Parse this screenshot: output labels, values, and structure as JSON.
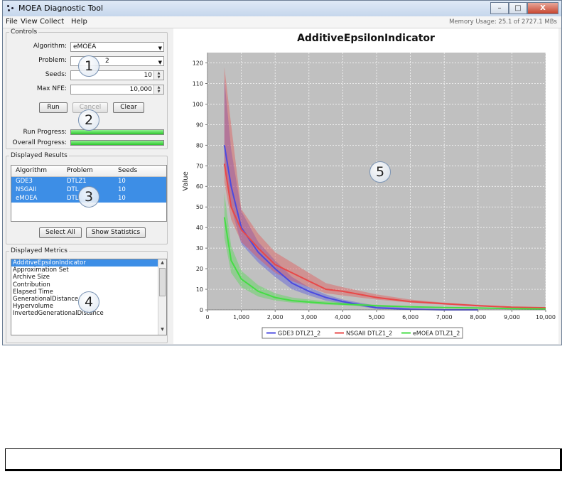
{
  "window": {
    "title": "MOEA Diagnostic Tool",
    "buttons": [
      "–",
      "□",
      "X"
    ]
  },
  "menu": {
    "items": [
      "File",
      "View",
      "Collect",
      "Help"
    ],
    "memory": "Memory Usage: 25.1 of 2727.1 MBs"
  },
  "controls": {
    "legend": "Controls",
    "algorithm_label": "Algorithm:",
    "algorithm_value": "eMOEA",
    "problem_label": "Problem:",
    "problem_value": "2",
    "seeds_label": "Seeds:",
    "seeds_value": "10",
    "maxnfe_label": "Max NFE:",
    "maxnfe_value": "10,000",
    "run_label": "Run",
    "cancel_label": "Cancel",
    "clear_label": "Clear",
    "run_progress_label": "Run Progress:",
    "overall_progress_label": "Overall Progress:",
    "run_progress": 1.0,
    "overall_progress": 1.0
  },
  "results": {
    "legend": "Displayed Results",
    "columns": [
      "Algorithm",
      "Problem",
      "Seeds"
    ],
    "rows": [
      {
        "algorithm": "GDE3",
        "problem": "DTLZ1",
        "seeds": "10"
      },
      {
        "algorithm": "NSGAII",
        "problem": "DTL",
        "seeds": "10"
      },
      {
        "algorithm": "eMOEA",
        "problem": "DTL",
        "seeds": "10"
      }
    ],
    "select_all_label": "Select All",
    "show_stats_label": "Show Statistics"
  },
  "metrics": {
    "legend": "Displayed Metrics",
    "items": [
      "AdditiveEpsilonIndicator",
      "Approximation Set",
      "Archive Size",
      "Contribution",
      "Elapsed Time",
      "GenerationalDistance",
      "Hypervolume",
      "InvertedGenerationalDistance"
    ]
  },
  "callouts": [
    "1",
    "2",
    "3",
    "4",
    "5"
  ],
  "colors": {
    "gde3": "#4a4ae0",
    "nsga": "#e84848",
    "emoea": "#44dd44",
    "plot_bg": "#c0c0c0",
    "selection": "#3d8ee6"
  },
  "chart_data": {
    "type": "line",
    "title": "AdditiveEpsilonIndicator",
    "xlabel": "",
    "ylabel": "Value",
    "xlim": [
      0,
      10000
    ],
    "ylim": [
      0,
      125
    ],
    "x_ticks": [
      0,
      1000,
      2000,
      3000,
      4000,
      5000,
      6000,
      7000,
      8000,
      9000,
      10000
    ],
    "x_tick_labels": [
      "0",
      "1,000",
      "2,000",
      "3,000",
      "4,000",
      "5,000",
      "6,000",
      "7,000",
      "8,000",
      "9,000",
      "10,000"
    ],
    "y_ticks": [
      0,
      10,
      20,
      30,
      40,
      50,
      60,
      70,
      80,
      90,
      100,
      110,
      120
    ],
    "grid": true,
    "legend_position": "bottom",
    "series": [
      {
        "name": "GDE3 DTLZ1_2",
        "color": "#4a4ae0",
        "x": [
          500,
          700,
          1000,
          1500,
          2000,
          2500,
          3000,
          3500,
          4000,
          5000,
          6000,
          7000,
          8000
        ],
        "y": [
          80,
          60,
          40,
          28,
          20,
          13,
          9,
          6,
          4,
          1,
          0.3,
          0,
          0
        ],
        "lower": [
          72,
          50,
          32,
          23,
          16,
          10,
          7,
          4.5,
          3,
          0.5,
          0,
          0,
          0
        ],
        "upper": [
          112,
          78,
          48,
          33,
          24,
          16,
          11,
          7.5,
          5,
          2,
          0.8,
          0.2,
          0
        ]
      },
      {
        "name": "NSGAII DTLZ1_2",
        "color": "#e84848",
        "x": [
          500,
          700,
          1000,
          1500,
          2000,
          2500,
          3000,
          3500,
          4000,
          5000,
          6000,
          7000,
          8000,
          9000,
          10000
        ],
        "y": [
          71,
          50,
          39,
          30,
          22,
          18,
          14,
          10,
          9,
          6,
          4,
          3,
          2,
          1.3,
          1
        ],
        "lower": [
          62,
          44,
          33,
          25,
          18,
          14,
          11,
          8,
          7,
          5,
          3.5,
          2.5,
          1.7,
          1.1,
          0.8
        ],
        "upper": [
          118,
          90,
          49,
          37,
          28,
          23,
          18,
          13,
          11,
          7.5,
          5,
          3.5,
          2.5,
          1.6,
          1.2
        ]
      },
      {
        "name": "eMOEA DTLZ1_2",
        "color": "#44dd44",
        "x": [
          500,
          700,
          1000,
          1500,
          2000,
          2500,
          3000,
          3500,
          4000,
          5000,
          6000,
          7000,
          8000,
          9000,
          10000
        ],
        "y": [
          45,
          24,
          15,
          9,
          6,
          4.5,
          3.8,
          3.2,
          2.8,
          2,
          1.5,
          1.1,
          0.9,
          0.6,
          0.5
        ],
        "lower": [
          35,
          18,
          11,
          6.5,
          4.5,
          3.5,
          3,
          2.5,
          2.2,
          1.6,
          1.2,
          0.9,
          0.7,
          0.5,
          0.4
        ],
        "upper": [
          57,
          31,
          19,
          12,
          8,
          6,
          5,
          4.2,
          3.5,
          2.5,
          1.9,
          1.4,
          1.1,
          0.8,
          0.6
        ]
      }
    ]
  }
}
